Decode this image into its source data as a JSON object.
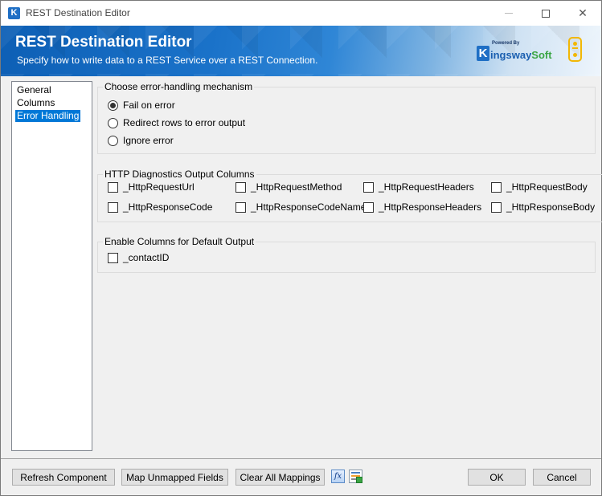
{
  "window": {
    "title": "REST Destination Editor",
    "app_icon_letter": "K",
    "close_glyph": "✕"
  },
  "banner": {
    "title": "REST Destination Editor",
    "subtitle": "Specify how to write data to a REST Service over a REST Connection.",
    "brand": {
      "k": "K",
      "powered_by": "Powered By",
      "kingsway": "ingsway",
      "soft": "Soft"
    }
  },
  "nav": {
    "items": [
      {
        "label": "General",
        "selected": false
      },
      {
        "label": "Columns",
        "selected": false
      },
      {
        "label": "Error Handling",
        "selected": true
      }
    ]
  },
  "error_handling": {
    "group_label": "Choose error-handling mechanism",
    "options": [
      {
        "label": "Fail on error",
        "checked": true
      },
      {
        "label": "Redirect rows to error output",
        "checked": false
      },
      {
        "label": "Ignore error",
        "checked": false
      }
    ]
  },
  "http_diagnostics": {
    "group_label": "HTTP Diagnostics Output Columns",
    "columns": [
      {
        "label": "_HttpRequestUrl",
        "checked": false
      },
      {
        "label": "_HttpRequestMethod",
        "checked": false
      },
      {
        "label": "_HttpRequestHeaders",
        "checked": false
      },
      {
        "label": "_HttpRequestBody",
        "checked": false
      },
      {
        "label": "_HttpResponseCode",
        "checked": false
      },
      {
        "label": "_HttpResponseCodeName",
        "checked": false
      },
      {
        "label": "_HttpResponseHeaders",
        "checked": false
      },
      {
        "label": "_HttpResponseBody",
        "checked": false
      }
    ]
  },
  "default_output": {
    "group_label": "Enable Columns for Default Output",
    "columns": [
      {
        "label": "_contactID",
        "checked": false
      }
    ]
  },
  "footer": {
    "refresh_label": "Refresh Component",
    "map_unmapped_label": "Map Unmapped Fields",
    "clear_mappings_label": "Clear All Mappings",
    "fx_glyph": "fx",
    "ok_label": "OK",
    "cancel_label": "Cancel"
  }
}
